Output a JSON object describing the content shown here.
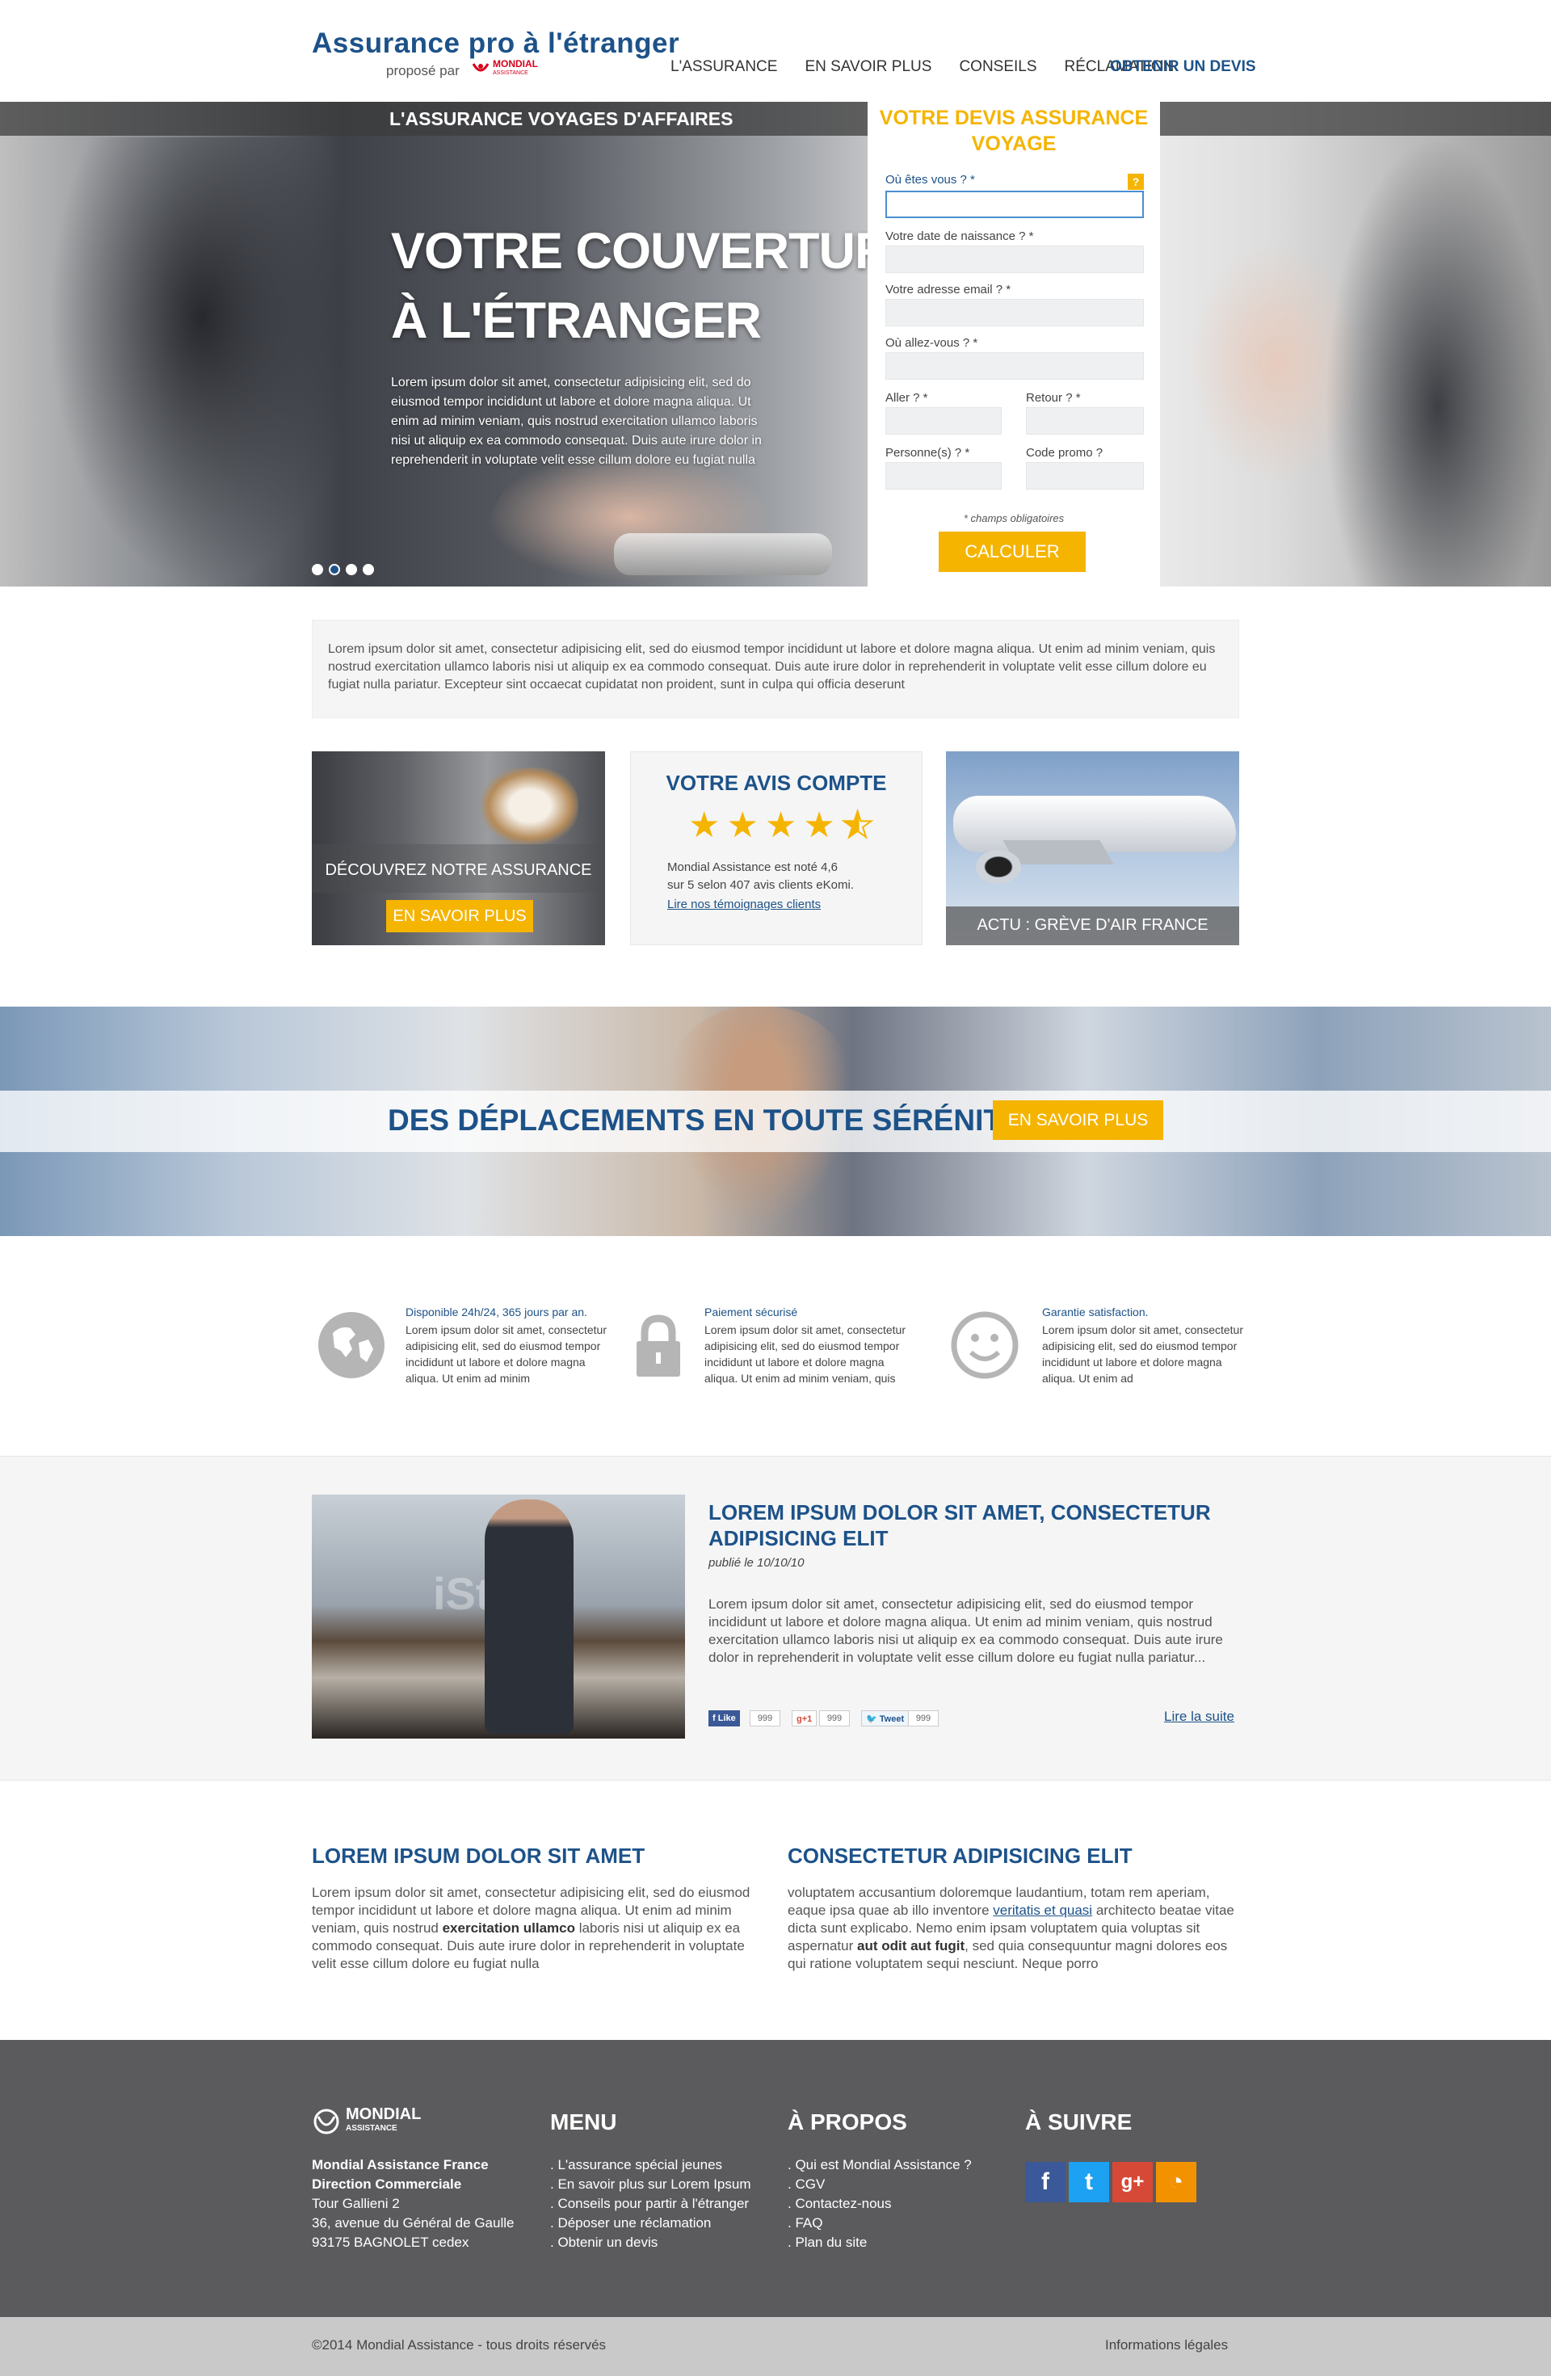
{
  "header": {
    "logo_title": "Assurance pro à l'étranger",
    "logo_sub": "proposé par",
    "mondial_name": "MONDIAL",
    "mondial_tag": "ASSISTANCE",
    "nav": [
      "L'ASSURANCE",
      "EN SAVOIR PLUS",
      "CONSEILS",
      "RÉCLAMATION"
    ],
    "cta": "OBTENIR UN DEVIS"
  },
  "hero": {
    "strip_title": "L'ASSURANCE VOYAGES D'AFFAIRES",
    "title_line1": "VOTRE COUVERTURE",
    "title_line2": "À L'ÉTRANGER",
    "text": "Lorem ipsum dolor sit amet, consectetur adipisicing elit, sed do eiusmod tempor incididunt ut labore et dolore magna aliqua. Ut enim ad minim veniam, quis nostrud exercitation ullamco laboris nisi ut aliquip ex ea commodo consequat. Duis aute irure dolor in reprehenderit in voluptate velit esse cillum dolore eu fugiat nulla",
    "slides": 4,
    "active_slide": 2
  },
  "quote": {
    "title": "VOTRE DEVIS ASSURANCE VOYAGE",
    "help": "?",
    "where_are_you": "Où êtes vous ? *",
    "birth_date": "Votre date de naissance ? *",
    "email": "Votre adresse email ? *",
    "destination": "Où allez-vous ? *",
    "departure": "Aller ? *",
    "return": "Retour ? *",
    "persons": "Personne(s) ? *",
    "promo": "Code promo ?",
    "required_note": "* champs obligatoires",
    "submit": "CALCULER"
  },
  "intro": {
    "text": "Lorem ipsum dolor sit amet, consectetur adipisicing elit, sed do eiusmod tempor incididunt ut labore et dolore magna aliqua. Ut enim ad minim veniam, quis nostrud exercitation ullamco laboris nisi ut aliquip ex ea commodo consequat. Duis aute irure dolor in reprehenderit in voluptate velit esse cillum dolore eu fugiat nulla pariatur. Excepteur sint occaecat cupidatat non proident, sunt in culpa qui officia deserunt"
  },
  "tiles": {
    "discover_label": "DÉCOUVREZ NOTRE ASSURANCE",
    "discover_button": "EN SAVOIR PLUS",
    "review_title": "VOTRE AVIS COMPTE",
    "rating": 4.6,
    "review_line1": "Mondial Assistance est noté 4,6",
    "review_line2": "sur 5 selon 407 avis clients eKomi.",
    "review_link": "Lire nos témoignages clients",
    "news_label": "ACTU : GRÈVE D'AIR FRANCE"
  },
  "banner": {
    "title": "DES DÉPLACEMENTS EN TOUTE SÉRÉNITÉ ?",
    "button": "EN SAVOIR PLUS"
  },
  "features": [
    {
      "icon": "globe-icon",
      "title": "Disponible 24h/24, 365 jours par an.",
      "text": "Lorem ipsum dolor sit amet, consectetur adipisicing elit, sed do eiusmod tempor incididunt ut labore et dolore magna aliqua. Ut enim ad minim"
    },
    {
      "icon": "lock-icon",
      "title": "Paiement sécurisé",
      "text": "Lorem ipsum dolor sit amet, consectetur adipisicing elit, sed do eiusmod tempor incididunt ut labore et dolore magna aliqua. Ut enim ad minim veniam, quis"
    },
    {
      "icon": "smiley-icon",
      "title": "Garantie satisfaction.",
      "text": "Lorem ipsum dolor sit amet, consectetur adipisicing elit, sed do eiusmod tempor incididunt ut labore et dolore magna aliqua. Ut enim ad"
    }
  ],
  "article": {
    "title": "LOREM IPSUM DOLOR SIT AMET, CONSECTETUR ADIPISICING ELIT",
    "date": "publié le 10/10/10",
    "text": "Lorem ipsum dolor sit amet, consectetur adipisicing elit, sed do eiusmod tempor incididunt ut labore et dolore magna aliqua. Ut enim ad minim veniam, quis nostrud exercitation ullamco laboris nisi ut aliquip ex ea commodo consequat. Duis aute irure dolor in reprehenderit in voluptate velit esse cillum dolore eu fugiat nulla pariatur...",
    "like_label": "Like",
    "like_count": "999",
    "gplus_label": "+1",
    "gplus_count": "999",
    "tweet_label": "Tweet",
    "tweet_count": "999",
    "read_more": "Lire la suite",
    "watermark": "iStock"
  },
  "columns": {
    "left_title": "LOREM IPSUM DOLOR SIT AMET",
    "left_text_a": "Lorem ipsum dolor sit amet, consectetur adipisicing elit, sed do eiusmod tempor incididunt ut labore et dolore magna aliqua. Ut enim ad minim veniam, quis nostrud ",
    "left_text_bold": "exercitation ullamco",
    "left_text_b": " laboris nisi ut aliquip ex ea commodo consequat. Duis aute irure dolor in reprehenderit in voluptate velit esse cillum dolore eu fugiat nulla",
    "right_title": "CONSECTETUR ADIPISICING ELIT",
    "right_text_a": "voluptatem accusantium doloremque laudantium, totam rem aperiam, eaque ipsa quae ab illo inventore ",
    "right_text_link": "veritatis et quasi",
    "right_text_b": " architecto beatae vitae dicta sunt explicabo. Nemo enim ipsam voluptatem quia voluptas sit aspernatur ",
    "right_text_bold": "aut odit aut fugit",
    "right_text_c": ", sed quia consequuntur magni dolores eos qui ratione voluptatem sequi nesciunt. Neque porro"
  },
  "footer": {
    "logo_name": "MONDIAL",
    "logo_tag": "ASSISTANCE",
    "company": "Mondial Assistance France",
    "department": "Direction Commerciale",
    "address1": "Tour Gallieni 2",
    "address2": "36, avenue du Général de Gaulle",
    "address3": "93175 BAGNOLET cedex",
    "menu_title": "MENU",
    "menu": [
      ". L'assurance spécial jeunes",
      ". En savoir plus sur Lorem Ipsum",
      ". Conseils pour partir à l'étranger",
      ". Déposer une réclamation",
      ". Obtenir un devis"
    ],
    "about_title": "À PROPOS",
    "about": [
      ". Qui est Mondial Assistance ?",
      ". CGV",
      ". Contactez-nous",
      ". FAQ",
      ". Plan du site"
    ],
    "follow_title": "À SUIVRE",
    "social": [
      {
        "icon": "facebook-icon",
        "glyph": "f",
        "color": "#3b5998"
      },
      {
        "icon": "twitter-icon",
        "glyph": "t",
        "color": "#1da1f2"
      },
      {
        "icon": "google-plus-icon",
        "glyph": "g+",
        "color": "#d64937"
      },
      {
        "icon": "rss-icon",
        "glyph": "◔",
        "color": "#f39200"
      }
    ],
    "copyright": "©2014 Mondial Assistance - tous droits réservés",
    "legal": "Informations légales"
  },
  "colors": {
    "brand_blue": "#1d5289",
    "accent_yellow": "#f5b400",
    "footer_grey": "#5b5b5e"
  }
}
